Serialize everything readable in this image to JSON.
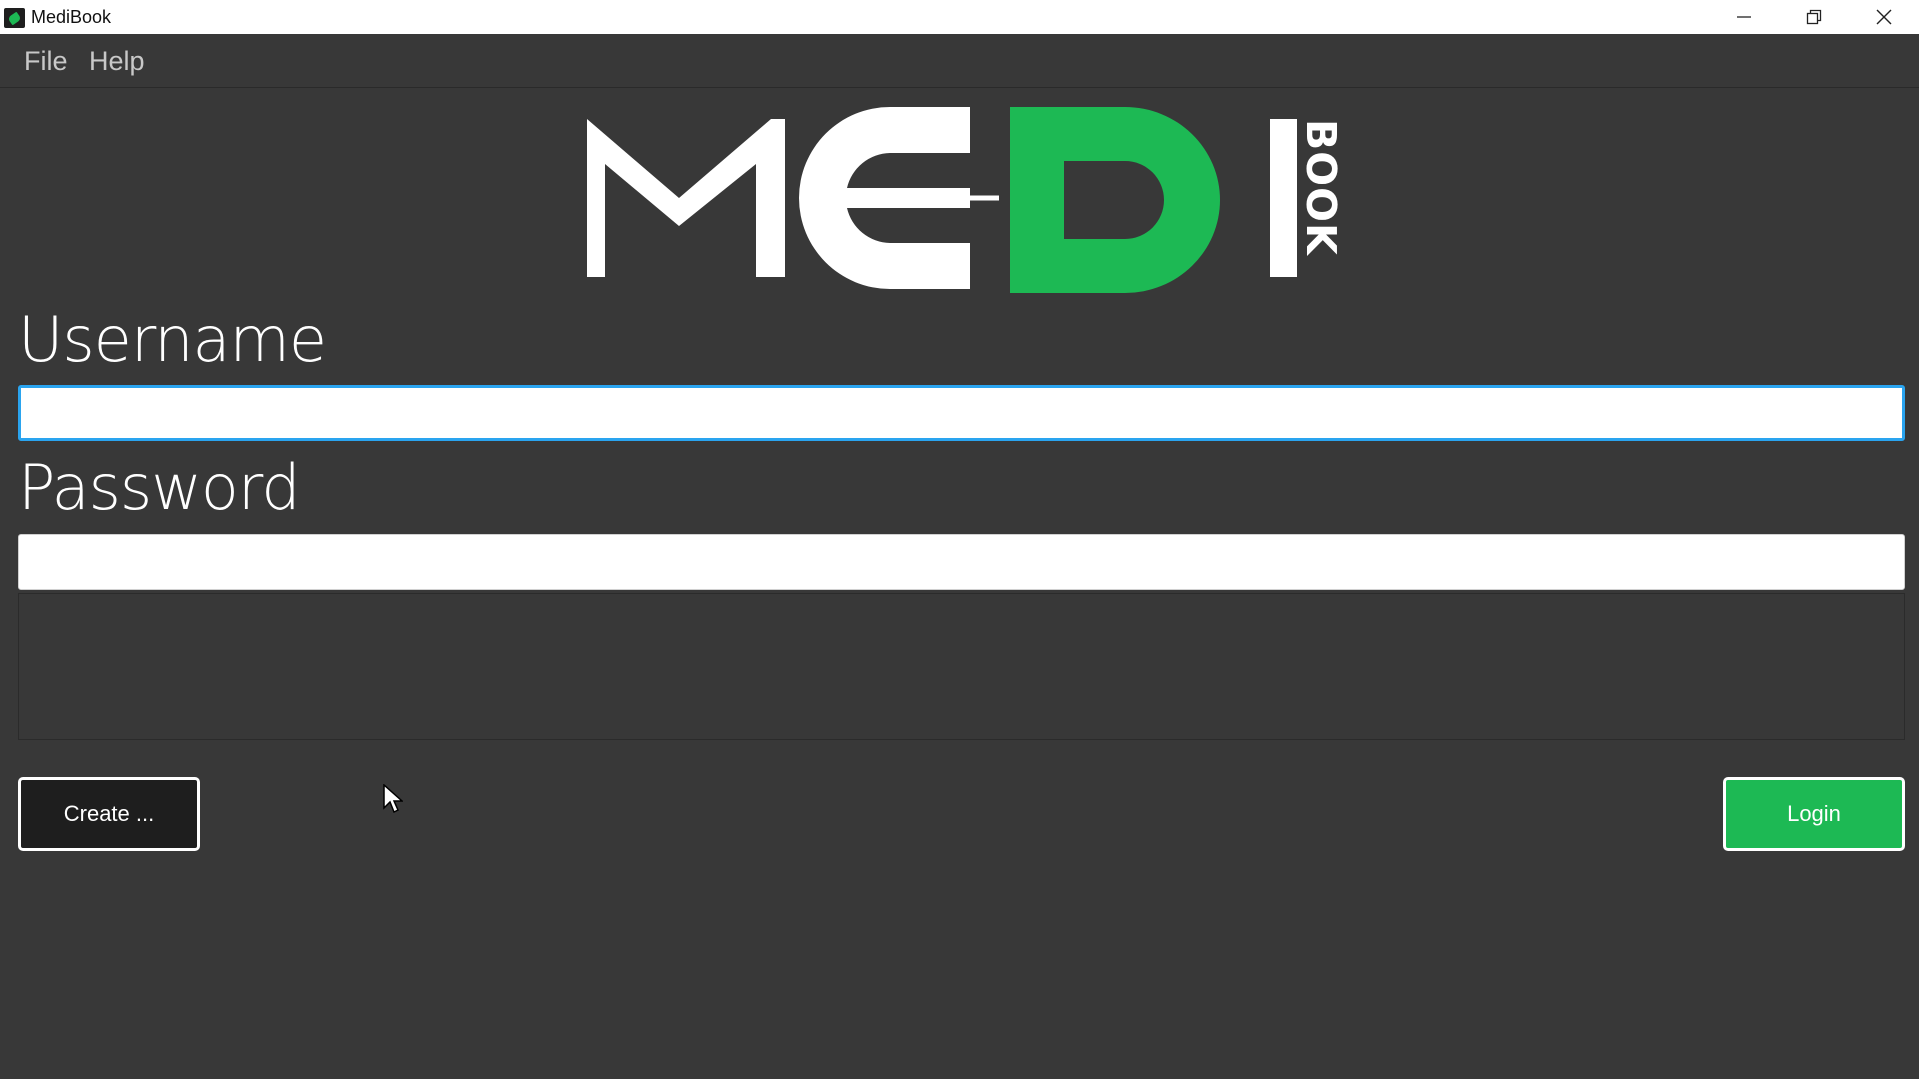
{
  "window": {
    "title": "MediBook",
    "controls": [
      "minimize",
      "restore",
      "close"
    ]
  },
  "menubar": {
    "items": [
      {
        "label": "File"
      },
      {
        "label": "Help"
      }
    ]
  },
  "logo": {
    "text": "MEDI",
    "side_text": "BOOK",
    "accent_color": "#1db954"
  },
  "form": {
    "username": {
      "label": "Username",
      "value": "",
      "placeholder": ""
    },
    "password": {
      "label": "Password",
      "value": "",
      "placeholder": ""
    },
    "message": ""
  },
  "buttons": {
    "create": "Create ...",
    "login": "Login"
  },
  "colors": {
    "background": "#383838",
    "accent": "#1db954",
    "focus": "#2aa4ef"
  }
}
